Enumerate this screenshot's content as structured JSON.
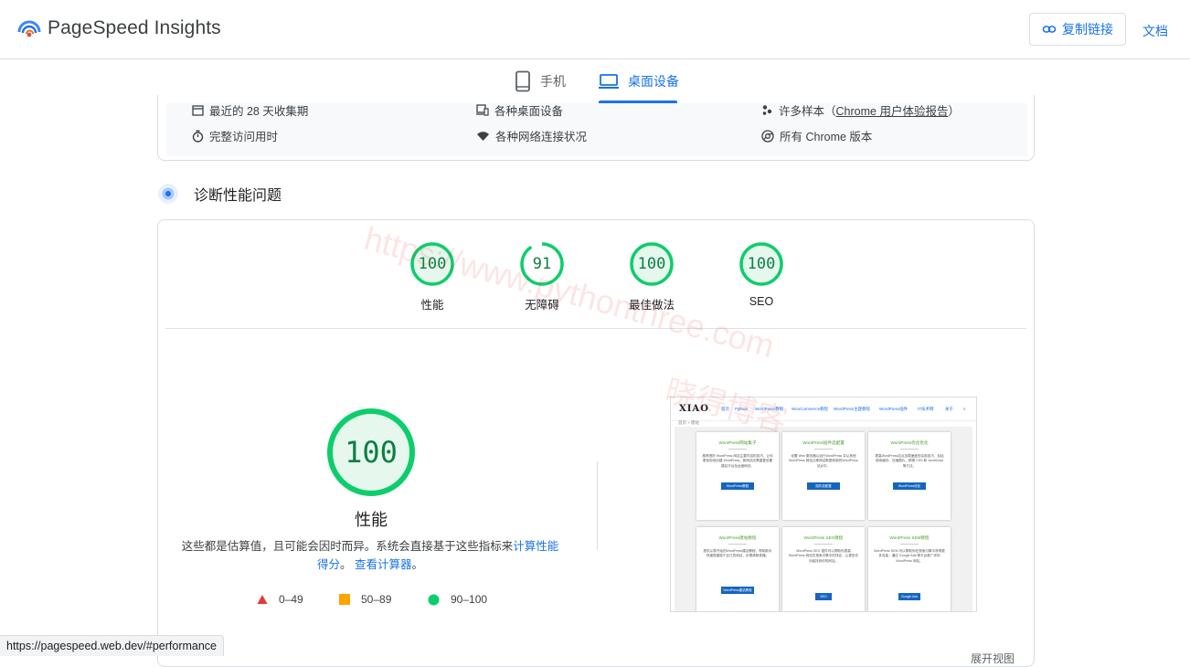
{
  "header": {
    "brand": "PageSpeed Insights",
    "copy_link": "复制链接",
    "docs": "文档",
    "logo_icon": "pagespeed-logo-icon",
    "link_icon": "link-icon"
  },
  "tabs": [
    {
      "label": "手机",
      "icon": "phone-icon",
      "active": false
    },
    {
      "label": "桌面设备",
      "icon": "laptop-icon",
      "active": true
    }
  ],
  "meta": {
    "period": "最近的 28 天收集期",
    "devices": "各种桌面设备",
    "samples_pre": "许多样本（",
    "samples_link": "Chrome 用户体验报告",
    "samples_post": "）",
    "duration": "完整访问用时",
    "network": "各种网络连接状况",
    "chrome": "所有 Chrome 版本"
  },
  "diagnose": {
    "title": "诊断性能问题",
    "icon": "lighthouse-icon"
  },
  "scores": [
    {
      "value": "100",
      "fraction": 1.0,
      "label": "性能"
    },
    {
      "value": "91",
      "fraction": 0.91,
      "label": "无障碍"
    },
    {
      "value": "100",
      "fraction": 1.0,
      "label": "最佳做法"
    },
    {
      "value": "100",
      "fraction": 1.0,
      "label": "SEO"
    }
  ],
  "performance": {
    "score": "100",
    "label": "性能",
    "desc_text": "这些都是估算值，且可能会因时而异。系统会直接基于这些指标来",
    "desc_link1": "计算性能得分",
    "desc_mid": "。",
    "desc_link2": "查看计算器",
    "desc_end": "。"
  },
  "legend": [
    {
      "range": "0–49",
      "shape": "triangle",
      "color": "#e53935"
    },
    {
      "range": "50–89",
      "shape": "square",
      "color": "#ffa400"
    },
    {
      "range": "90–100",
      "shape": "circle",
      "color": "#0cce6b"
    }
  ],
  "screenshot": {
    "logo": "XIAO",
    "menu": [
      "首页",
      "Python",
      "WordPress教程",
      "WooCommerce教程",
      "WordPress主题教程",
      "WordPress插件",
      "IT技术网",
      "关于"
    ],
    "crumb": "首页 » 建站",
    "tiles": [
      {
        "title": "WordPress网站集子",
        "desc": "推荐搭好 WordPress 网站主要内容的技巧，让你更轻松地创建 WordPress。新网站无需重复设置建站平台及运营网页。",
        "button": "WordPress教程"
      },
      {
        "title": "WordPress插件选配置",
        "desc": "设置 Web 服务器以运行WordPress 并从其他 WordPress 网站迁移网站数据到新的WordPress站点中。",
        "button": "插件选配置"
      },
      {
        "title": "WordPress优化优化",
        "desc": "提高WordPress站点加载速度的实用技巧，包括使用缓存、压缩图片、精简 CSS 和 JavaScript 等方法。",
        "button": "WordPress优化"
      },
      {
        "title": "WordPress建站教程",
        "desc": "提供从零开始的WordPress建站教程，帮助新手快速搭建属于自己的网站，步骤清晰易懂。",
        "button": "WordPress建站教程"
      },
      {
        "title": "WordPress SEO教程",
        "desc": "WordPress SEO 插件可以帮助你提高 WordPress 网站在搜索引擎中的排名，让更多访问者找到你的网站。",
        "button": "SEO"
      },
      {
        "title": "WordPress SEM教程",
        "desc": "WordPress SEM 可以帮助你在搜索引擎中获得更多流量，通过 Google Ads 等平台推广你的 WordPress 网站。",
        "button": "Google Ads"
      }
    ]
  },
  "status_bar": {
    "url": "https://pagespeed.web.dev/#performance"
  },
  "watermark": {
    "url": "https://www.pythonthree.com",
    "site": "晓得博客"
  },
  "footer_peek": "展开视图"
}
